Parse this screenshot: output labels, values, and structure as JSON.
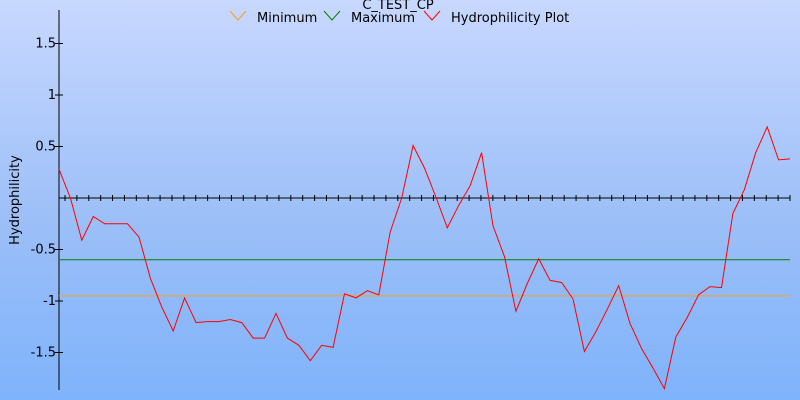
{
  "chart_data": {
    "type": "line",
    "title": "C_TEST_CP",
    "ylabel": "Hydrophilicity",
    "xlabel": "",
    "ylim": [
      -1.85,
      1.85
    ],
    "yticks": [
      {
        "value": 1.5,
        "label": "1.5"
      },
      {
        "value": 1,
        "label": "1"
      },
      {
        "value": 0.5,
        "label": "0.5"
      },
      {
        "value": -0.5,
        "label": "-0.5"
      },
      {
        "value": -1,
        "label": "-1"
      },
      {
        "value": -1.5,
        "label": "-1.5"
      }
    ],
    "x_minor_ticks": 62,
    "legend_position": "top",
    "series": [
      {
        "name": "Minimum",
        "color": "#f5a020",
        "kind": "hline",
        "value": -0.95
      },
      {
        "name": "Maximum",
        "color": "#008000",
        "kind": "hline",
        "value": -0.6
      },
      {
        "name": "Hydrophilicity Plot",
        "color": "#ff0000",
        "kind": "line",
        "values": [
          0.28,
          0.0,
          -0.41,
          -0.18,
          -0.25,
          -0.25,
          -0.25,
          -0.38,
          -0.78,
          -1.06,
          -1.29,
          -0.97,
          -1.21,
          -1.2,
          -1.2,
          -1.18,
          -1.21,
          -1.36,
          -1.36,
          -1.12,
          -1.36,
          -1.43,
          -1.58,
          -1.43,
          -1.45,
          -0.93,
          -0.97,
          -0.9,
          -0.94,
          -0.33,
          0.0,
          0.51,
          0.29,
          0.01,
          -0.29,
          -0.07,
          0.12,
          0.44,
          -0.27,
          -0.57,
          -1.1,
          -0.83,
          -0.59,
          -0.8,
          -0.82,
          -0.98,
          -1.49,
          -1.3,
          -1.08,
          -0.85,
          -1.22,
          -1.46,
          -1.65,
          -1.85,
          -1.35,
          -1.16,
          -0.94,
          -0.86,
          -0.87,
          -0.15,
          0.08,
          0.44,
          0.69,
          0.37,
          0.38
        ]
      }
    ]
  }
}
